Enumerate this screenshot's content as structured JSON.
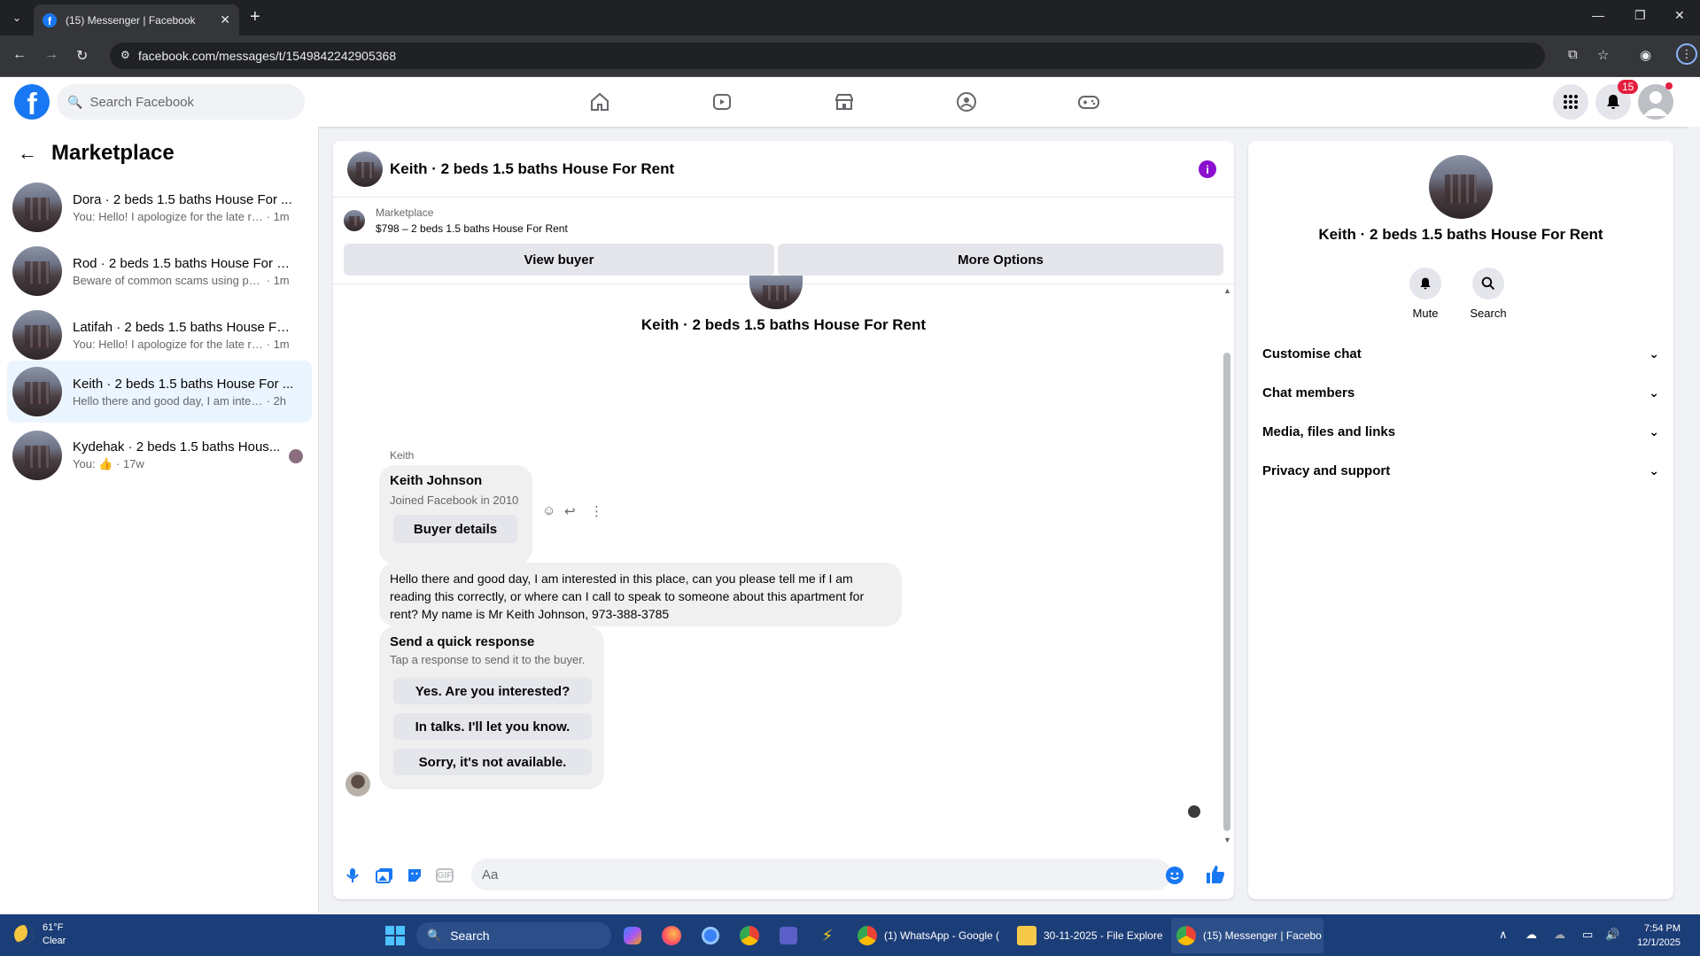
{
  "browser": {
    "tab_title": "(15) Messenger | Facebook",
    "url": "facebook.com/messages/t/1549842242905368",
    "new_tab": "+",
    "minimize": "—",
    "restore": "❐",
    "close": "✕"
  },
  "fb_header": {
    "search_placeholder": "Search Facebook",
    "notification_count": "15",
    "logo_letter": "f"
  },
  "left_panel": {
    "title": "Marketplace",
    "conversations": [
      {
        "name": "Dora · 2 beds 1.5 baths House For ...",
        "preview": "You: Hello! I apologize for the late re...",
        "time": "1m"
      },
      {
        "name": "Rod · 2 beds 1.5 baths House For R...",
        "preview": "Beware of common scams using pay...",
        "time": "1m"
      },
      {
        "name": "Latifah · 2 beds 1.5 baths House Fo...",
        "preview": "You: Hello! I apologize for the late re...",
        "time": "1m"
      },
      {
        "name": "Keith · 2 beds 1.5 baths House For ...",
        "preview": "Hello there and good day, I am intere...",
        "time": "2h"
      },
      {
        "name": "Kydehak · 2 beds 1.5 baths Hous...",
        "preview": "You:",
        "time": "17w"
      }
    ]
  },
  "chat": {
    "header_title": "Keith · 2 beds 1.5 baths House For Rent",
    "marketplace_label": "Marketplace",
    "listing": "$798 – 2 beds 1.5 baths House For Rent",
    "view_buyer": "View buyer",
    "more_options": "More Options",
    "conversation_title": "Keith · 2 beds 1.5 baths House For Rent",
    "sender": "Keith",
    "card_name": "Keith Johnson",
    "card_joined": "Joined Facebook in 2010",
    "buyer_details": "Buyer details",
    "message": "Hello there and good day, I am interested in this place, can you please tell me if I am reading this correctly, or where can I call to speak to someone about this apartment for rent? My name is Mr Keith Johnson, 973-388-3785",
    "quick_title": "Send a quick response",
    "quick_subtitle": "Tap a response to send it to the buyer.",
    "quick_responses": [
      "Yes. Are you interested?",
      "In talks. I'll let you know.",
      "Sorry, it's not available."
    ],
    "input_placeholder": "Aa",
    "gif_label": "GIF"
  },
  "right_panel": {
    "name": "Keith · 2 beds 1.5 baths House For Rent",
    "mute": "Mute",
    "search": "Search",
    "sections": [
      "Customise chat",
      "Chat members",
      "Media, files and links",
      "Privacy and support"
    ]
  },
  "taskbar": {
    "temp": "61°F",
    "condition": "Clear",
    "search_label": "Search",
    "windows": [
      "(1) WhatsApp - Google (",
      "30-11-2025 - File Explore",
      "(15) Messenger | Facebo"
    ],
    "time": "7:54 PM",
    "date": "12/1/2025"
  },
  "colors": {
    "brand": "#1877f2",
    "active_conv": "#ebf5ff",
    "badge": "#e41e3f",
    "info": "#8a0fcf",
    "taskbar": "#1c3e78"
  }
}
